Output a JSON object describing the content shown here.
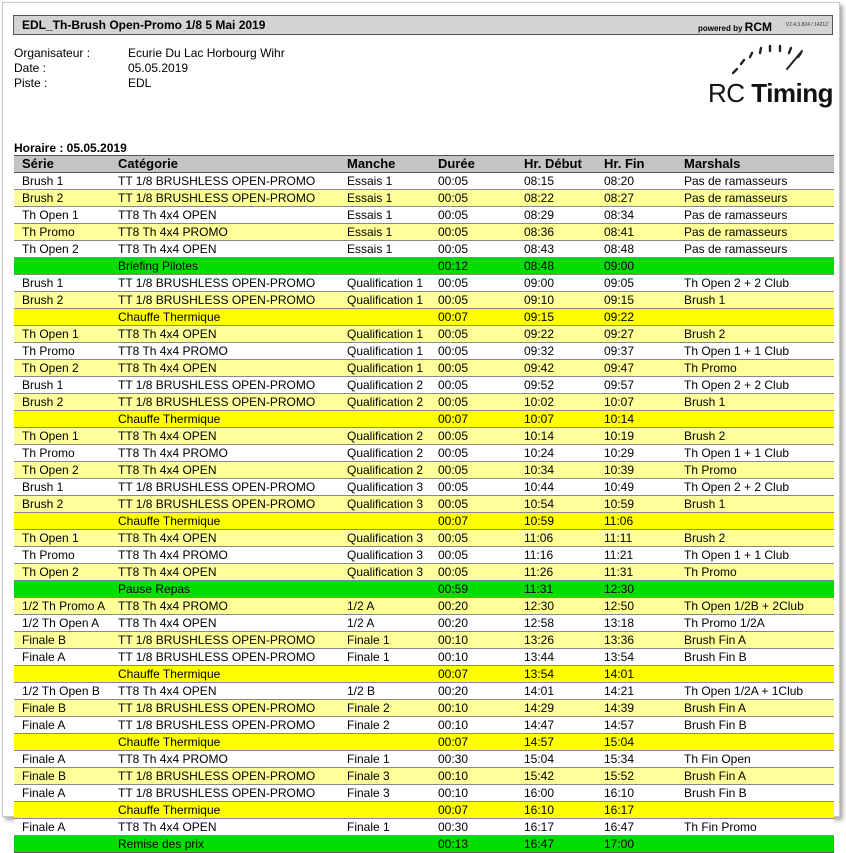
{
  "header": {
    "title": "EDL_Th-Brush Open-Promo 1/8 5 Mai 2019",
    "powered_by": "powered by",
    "brand": "RCM",
    "version": "V2.4.3.824 / 14212"
  },
  "info": [
    {
      "label": "Organisateur :",
      "value": "Ecurie Du Lac Horbourg Wihr"
    },
    {
      "label": "Date :",
      "value": "05.05.2019"
    },
    {
      "label": "Piste :",
      "value": "EDL"
    }
  ],
  "logo": {
    "text_a": "RC ",
    "text_b": "Timing"
  },
  "horaire": "Horaire : 05.05.2019",
  "table": {
    "headers": [
      "Série",
      "Catégorie",
      "Manche",
      "Durée",
      "Hr. Début",
      "Hr. Fin",
      "Marshals"
    ],
    "row_colors": {
      "w": "#ffffff",
      "y": "#ffff99",
      "b": "#ffff00",
      "g": "#00dd00"
    },
    "rows": [
      {
        "s": "w",
        "c": [
          "Brush 1",
          "TT 1/8 BRUSHLESS OPEN-PROMO",
          "Essais 1",
          "00:05",
          "08:15",
          "08:20",
          "Pas de ramasseurs"
        ]
      },
      {
        "s": "y",
        "c": [
          "Brush 2",
          "TT 1/8 BRUSHLESS OPEN-PROMO",
          "Essais 1",
          "00:05",
          "08:22",
          "08:27",
          "Pas de ramasseurs"
        ]
      },
      {
        "s": "w",
        "c": [
          "Th Open 1",
          "TT8 Th 4x4 OPEN",
          "Essais 1",
          "00:05",
          "08:29",
          "08:34",
          "Pas de ramasseurs"
        ]
      },
      {
        "s": "y",
        "c": [
          "Th Promo",
          "TT8 Th 4x4 PROMO",
          "Essais 1",
          "00:05",
          "08:36",
          "08:41",
          "Pas de ramasseurs"
        ]
      },
      {
        "s": "w",
        "c": [
          "Th Open 2",
          "TT8 Th 4x4 OPEN",
          "Essais 1",
          "00:05",
          "08:43",
          "08:48",
          "Pas de ramasseurs"
        ]
      },
      {
        "s": "g",
        "c": [
          "",
          "Briefing Pilotes",
          "",
          "00:12",
          "08:48",
          "09:00",
          ""
        ]
      },
      {
        "s": "w",
        "c": [
          "Brush 1",
          "TT 1/8 BRUSHLESS OPEN-PROMO",
          "Qualification 1",
          "00:05",
          "09:00",
          "09:05",
          "Th Open 2 + 2 Club"
        ]
      },
      {
        "s": "y",
        "c": [
          "Brush 2",
          "TT 1/8 BRUSHLESS OPEN-PROMO",
          "Qualification 1",
          "00:05",
          "09:10",
          "09:15",
          "Brush 1"
        ]
      },
      {
        "s": "b",
        "c": [
          "",
          "Chauffe Thermique",
          "",
          "00:07",
          "09:15",
          "09:22",
          ""
        ]
      },
      {
        "s": "y",
        "c": [
          "Th Open 1",
          "TT8 Th 4x4 OPEN",
          "Qualification 1",
          "00:05",
          "09:22",
          "09:27",
          "Brush 2"
        ]
      },
      {
        "s": "w",
        "c": [
          "Th Promo",
          "TT8 Th 4x4 PROMO",
          "Qualification 1",
          "00:05",
          "09:32",
          "09:37",
          "Th Open 1 + 1 Club"
        ]
      },
      {
        "s": "y",
        "c": [
          "Th Open 2",
          "TT8 Th 4x4 OPEN",
          "Qualification 1",
          "00:05",
          "09:42",
          "09:47",
          "Th Promo"
        ]
      },
      {
        "s": "w",
        "c": [
          "Brush 1",
          "TT 1/8 BRUSHLESS OPEN-PROMO",
          "Qualification 2",
          "00:05",
          "09:52",
          "09:57",
          "Th Open 2 + 2 Club"
        ]
      },
      {
        "s": "y",
        "c": [
          "Brush 2",
          "TT 1/8 BRUSHLESS OPEN-PROMO",
          "Qualification 2",
          "00:05",
          "10:02",
          "10:07",
          "Brush 1"
        ]
      },
      {
        "s": "b",
        "c": [
          "",
          "Chauffe Thermique",
          "",
          "00:07",
          "10:07",
          "10:14",
          ""
        ]
      },
      {
        "s": "y",
        "c": [
          "Th Open 1",
          "TT8 Th 4x4 OPEN",
          "Qualification 2",
          "00:05",
          "10:14",
          "10:19",
          "Brush 2"
        ]
      },
      {
        "s": "w",
        "c": [
          "Th Promo",
          "TT8 Th 4x4 PROMO",
          "Qualification 2",
          "00:05",
          "10:24",
          "10:29",
          "Th Open 1 + 1 Club"
        ]
      },
      {
        "s": "y",
        "c": [
          "Th Open 2",
          "TT8 Th 4x4 OPEN",
          "Qualification 2",
          "00:05",
          "10:34",
          "10:39",
          "Th Promo"
        ]
      },
      {
        "s": "w",
        "c": [
          "Brush 1",
          "TT 1/8 BRUSHLESS OPEN-PROMO",
          "Qualification 3",
          "00:05",
          "10:44",
          "10:49",
          "Th Open 2 + 2 Club"
        ]
      },
      {
        "s": "y",
        "c": [
          "Brush 2",
          "TT 1/8 BRUSHLESS OPEN-PROMO",
          "Qualification 3",
          "00:05",
          "10:54",
          "10:59",
          "Brush 1"
        ]
      },
      {
        "s": "b",
        "c": [
          "",
          "Chauffe Thermique",
          "",
          "00:07",
          "10:59",
          "11:06",
          ""
        ]
      },
      {
        "s": "y",
        "c": [
          "Th Open 1",
          "TT8 Th 4x4 OPEN",
          "Qualification 3",
          "00:05",
          "11:06",
          "11:11",
          "Brush 2"
        ]
      },
      {
        "s": "w",
        "c": [
          "Th Promo",
          "TT8 Th 4x4 PROMO",
          "Qualification 3",
          "00:05",
          "11:16",
          "11:21",
          "Th Open 1 + 1 Club"
        ]
      },
      {
        "s": "y",
        "c": [
          "Th Open 2",
          "TT8 Th 4x4 OPEN",
          "Qualification 3",
          "00:05",
          "11:26",
          "11:31",
          "Th Promo"
        ]
      },
      {
        "s": "g",
        "c": [
          "",
          "Pause Repas",
          "",
          "00:59",
          "11:31",
          "12:30",
          ""
        ]
      },
      {
        "s": "y",
        "c": [
          "1/2 Th Promo A",
          "TT8 Th 4x4 PROMO",
          "1/2 A",
          "00:20",
          "12:30",
          "12:50",
          "Th Open 1/2B + 2Club"
        ]
      },
      {
        "s": "w",
        "c": [
          "1/2 Th Open A",
          "TT8 Th 4x4 OPEN",
          "1/2 A",
          "00:20",
          "12:58",
          "13:18",
          "Th Promo 1/2A"
        ]
      },
      {
        "s": "y",
        "c": [
          "Finale B",
          "TT 1/8 BRUSHLESS OPEN-PROMO",
          "Finale 1",
          "00:10",
          "13:26",
          "13:36",
          "Brush Fin A"
        ]
      },
      {
        "s": "w",
        "c": [
          "Finale A",
          "TT 1/8 BRUSHLESS OPEN-PROMO",
          "Finale 1",
          "00:10",
          "13:44",
          "13:54",
          "Brush Fin B"
        ]
      },
      {
        "s": "b",
        "c": [
          "",
          "Chauffe Thermique",
          "",
          "00:07",
          "13:54",
          "14:01",
          ""
        ]
      },
      {
        "s": "w",
        "c": [
          "1/2 Th Open B",
          "TT8 Th 4x4 OPEN",
          "1/2 B",
          "00:20",
          "14:01",
          "14:21",
          "Th Open 1/2A + 1Club"
        ]
      },
      {
        "s": "y",
        "c": [
          "Finale B",
          "TT 1/8 BRUSHLESS OPEN-PROMO",
          "Finale 2",
          "00:10",
          "14:29",
          "14:39",
          "Brush Fin A"
        ]
      },
      {
        "s": "w",
        "c": [
          "Finale A",
          "TT 1/8 BRUSHLESS OPEN-PROMO",
          "Finale 2",
          "00:10",
          "14:47",
          "14:57",
          "Brush Fin B"
        ]
      },
      {
        "s": "b",
        "c": [
          "",
          "Chauffe Thermique",
          "",
          "00:07",
          "14:57",
          "15:04",
          ""
        ]
      },
      {
        "s": "w",
        "c": [
          "Finale A",
          "TT8 Th 4x4 PROMO",
          "Finale 1",
          "00:30",
          "15:04",
          "15:34",
          "Th Fin Open"
        ]
      },
      {
        "s": "y",
        "c": [
          "Finale B",
          "TT 1/8 BRUSHLESS OPEN-PROMO",
          "Finale 3",
          "00:10",
          "15:42",
          "15:52",
          "Brush Fin A"
        ]
      },
      {
        "s": "w",
        "c": [
          "Finale A",
          "TT 1/8 BRUSHLESS OPEN-PROMO",
          "Finale 3",
          "00:10",
          "16:00",
          "16:10",
          "Brush Fin B"
        ]
      },
      {
        "s": "b",
        "c": [
          "",
          "Chauffe Thermique",
          "",
          "00:07",
          "16:10",
          "16:17",
          ""
        ]
      },
      {
        "s": "w",
        "c": [
          "Finale A",
          "TT8 Th 4x4 OPEN",
          "Finale 1",
          "00:30",
          "16:17",
          "16:47",
          "Th Fin Promo"
        ]
      },
      {
        "s": "g",
        "c": [
          "",
          "Remise des prix",
          "",
          "00:13",
          "16:47",
          "17:00",
          ""
        ]
      }
    ]
  }
}
